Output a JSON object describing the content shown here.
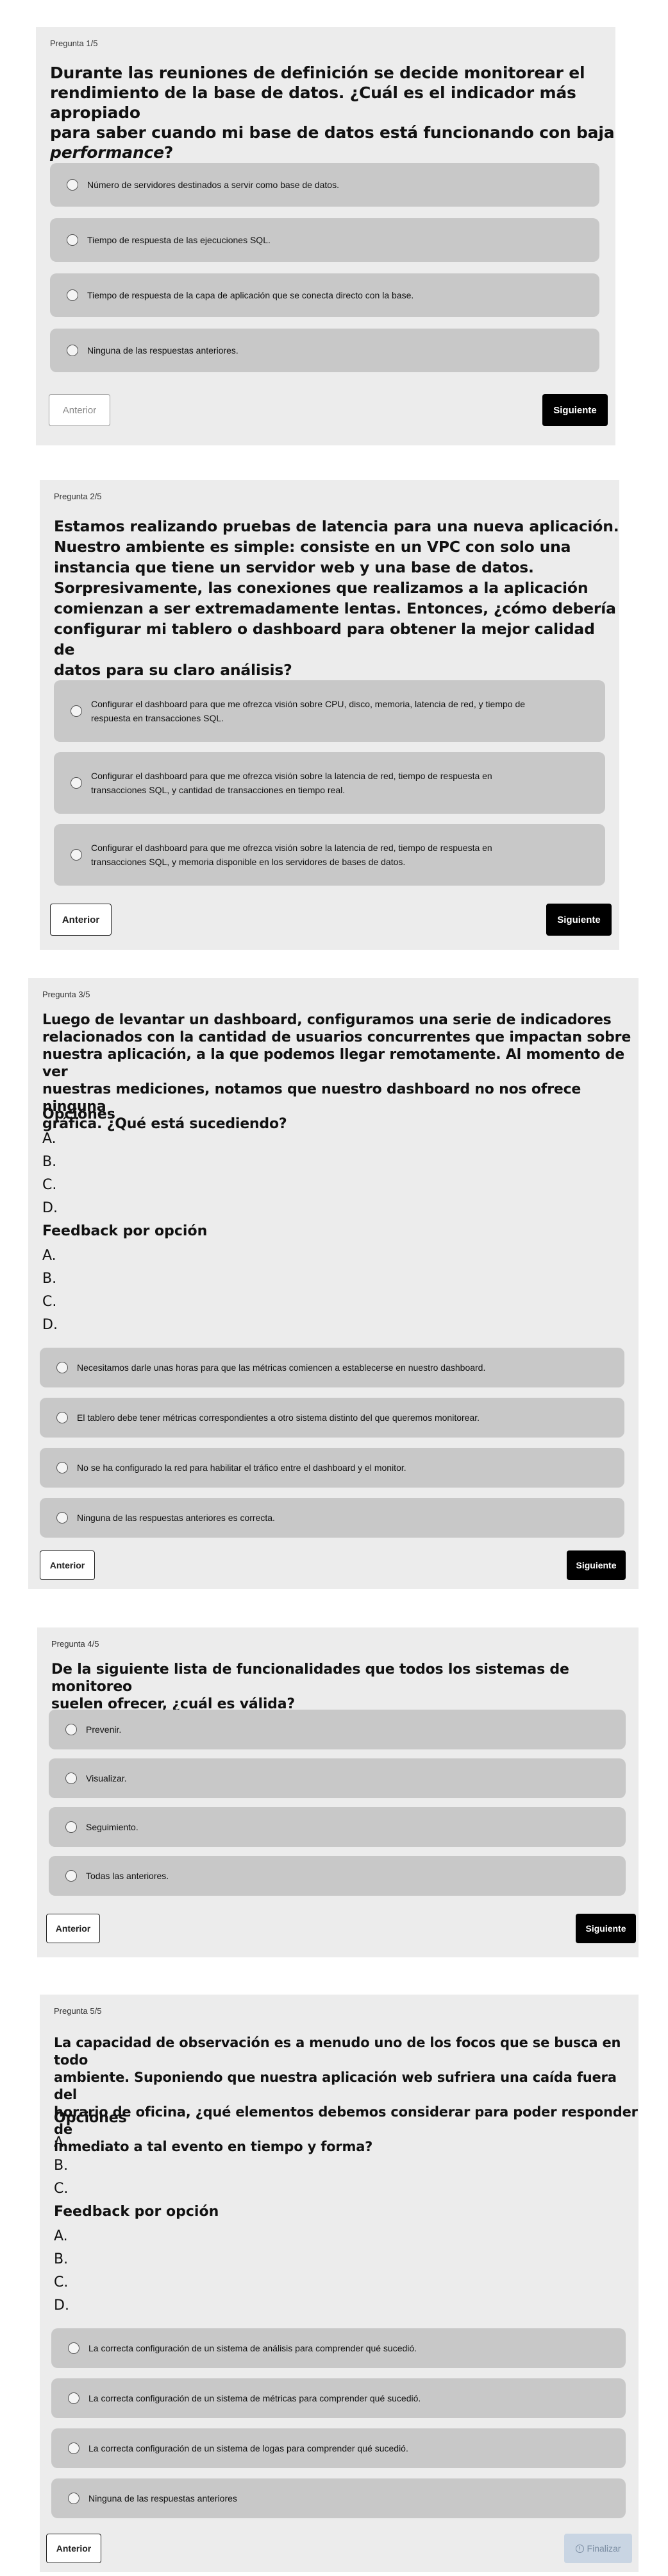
{
  "q1": {
    "label": "Pregunta 1/5",
    "question_parts": [
      "Durante las reuniones de definición se decide monitorear el",
      "rendimiento de la base de datos. ¿Cuál es el indicador más apropiado",
      "para saber cuando mi base de datos está funcionando con baja"
    ],
    "question_italic": "performance",
    "question_tail": "?",
    "options": [
      "Número de servidores destinados a servir como base de datos.",
      "Tiempo de respuesta de las ejecuciones SQL.",
      "Tiempo de respuesta de la capa de aplicación que se conecta directo con la base.",
      "Ninguna de las respuestas anteriores."
    ],
    "prev_label": "Anterior",
    "next_label": "Siguiente"
  },
  "q2": {
    "label": "Pregunta 2/5",
    "question_lines": [
      "Estamos realizando pruebas de latencia para una nueva aplicación.",
      "Nuestro ambiente es simple: consiste en un VPC con solo una",
      "instancia que tiene un servidor web y una base de datos.",
      "Sorpresivamente, las conexiones que realizamos a la aplicación",
      "comienzan a ser extremadamente lentas. Entonces, ¿cómo debería",
      "configurar mi tablero o dashboard para obtener la mejor calidad de",
      "datos para su claro análisis?"
    ],
    "options": [
      [
        "Configurar el dashboard para que me ofrezca visión sobre CPU, disco, memoria, latencia de red, y tiempo de",
        "respuesta en transacciones SQL."
      ],
      [
        "Configurar el dashboard para que me ofrezca visión sobre la latencia de red, tiempo de respuesta en",
        "transacciones SQL, y cantidad de transacciones en tiempo real."
      ],
      [
        "Configurar el dashboard para que me ofrezca visión sobre la latencia de red, tiempo de respuesta en",
        "transacciones SQL, y memoria disponible en los servidores de bases de datos."
      ]
    ],
    "prev_label": "Anterior",
    "next_label": "Siguiente"
  },
  "q3": {
    "label": "Pregunta 3/5",
    "question_lines": [
      "Luego de levantar un dashboard, configuramos una serie de indicadores",
      "relacionados con la cantidad de usuarios concurrentes que impactan sobre",
      "nuestra aplicación, a la que podemos llegar remotamente. Al momento de ver",
      "nuestras mediciones, notamos que nuestro dashboard no nos ofrece ninguna",
      "gráfica. ¿Qué está sucediendo?"
    ],
    "options_heading": "Opciones",
    "option_letters": [
      "A.",
      "B.",
      "C.",
      "D."
    ],
    "feedback_heading": "Feedback por opción",
    "feedback_letters": [
      "A.",
      "B.",
      "C.",
      "D."
    ],
    "options": [
      "Necesitamos darle unas horas para que las métricas comiencen a establecerse en nuestro dashboard.",
      "El tablero debe tener métricas correspondientes a otro sistema distinto del que queremos monitorear.",
      "No se ha configurado la red para habilitar el tráfico entre el dashboard y el monitor.",
      "Ninguna de las respuestas anteriores es correcta."
    ],
    "prev_label": "Anterior",
    "next_label": "Siguiente"
  },
  "q4": {
    "label": "Pregunta 4/5",
    "question_lines": [
      "De la siguiente lista de funcionalidades que todos los sistemas de monitoreo",
      "suelen ofrecer, ¿cuál es válida?"
    ],
    "options": [
      "Prevenir.",
      "Visualizar.",
      "Seguimiento.",
      "Todas las anteriores."
    ],
    "prev_label": "Anterior",
    "next_label": "Siguiente"
  },
  "q5": {
    "label": "Pregunta 5/5",
    "question_lines": [
      "La capacidad de observación es a menudo uno de los focos que se busca en todo",
      "ambiente. Suponiendo que nuestra aplicación web sufriera una caída fuera del",
      "horario de oficina, ¿qué elementos debemos considerar para poder responder de",
      "inmediato a tal evento en tiempo y forma?"
    ],
    "options_heading": "Opciones",
    "option_letters": [
      "A.",
      "B.",
      "C."
    ],
    "feedback_heading": "Feedback por opción",
    "feedback_letters": [
      "A.",
      "B.",
      "C.",
      "D."
    ],
    "options": [
      "La correcta configuración de un sistema de análisis para comprender qué sucedió.",
      "La correcta configuración de un sistema de métricas para comprender qué sucedió.",
      "La correcta configuración de un sistema de logas para comprender qué sucedió.",
      "Ninguna de las respuestas anteriores"
    ],
    "prev_label": "Anterior",
    "finish_label": "Finalizar",
    "finish_icon": "info-circle-icon"
  },
  "colors": {
    "card_bg": "#ececec",
    "option_bg": "#c8c8c8",
    "primary_button": "#000000",
    "finish_button_disabled": "#c9d5e3"
  }
}
